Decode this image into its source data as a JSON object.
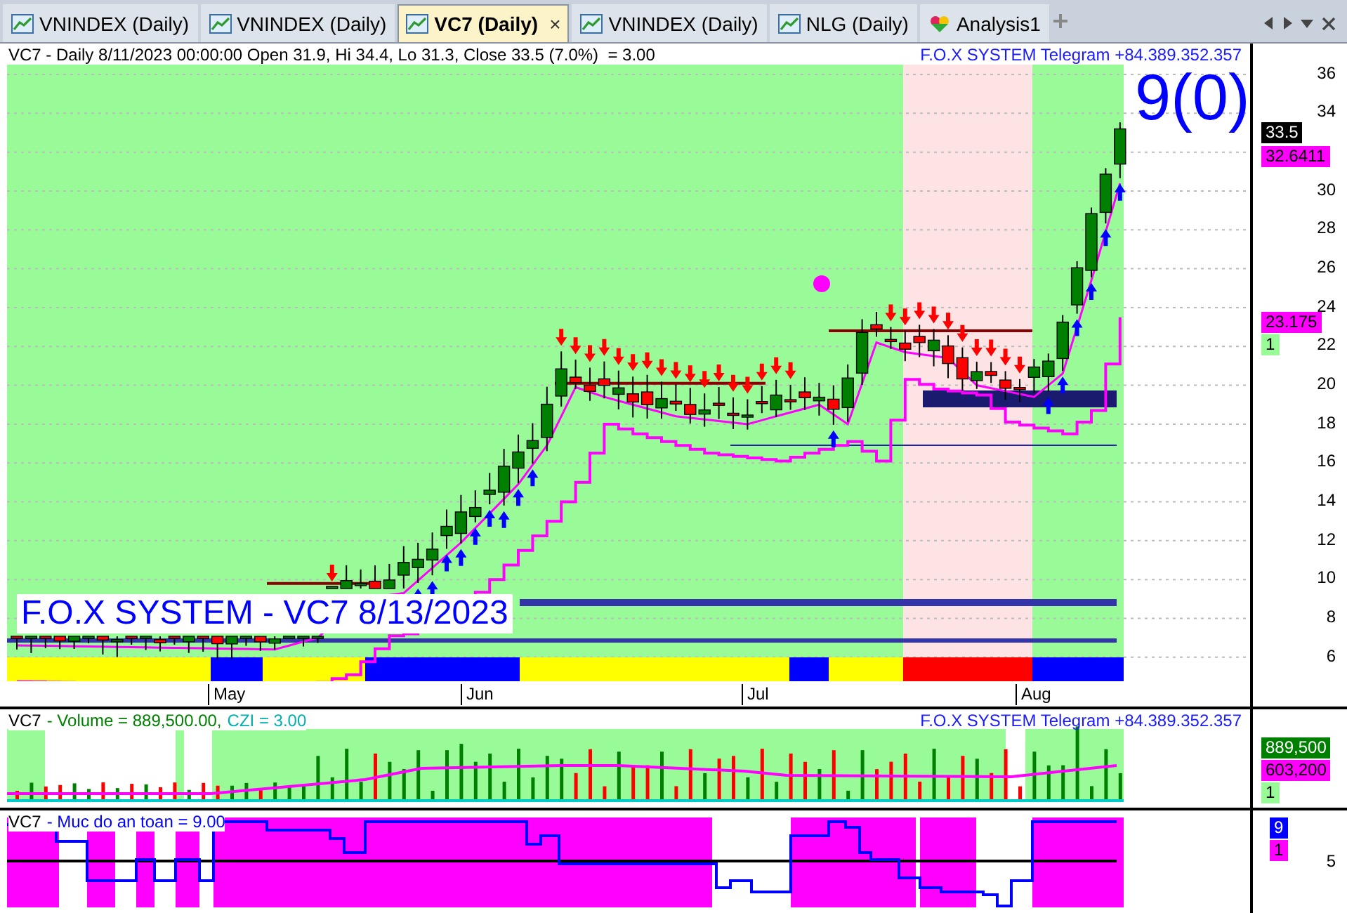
{
  "tabs": [
    {
      "kind": "chart",
      "label": "VNINDEX (Daily)",
      "selected": false
    },
    {
      "kind": "chart",
      "label": "VNINDEX (Daily)",
      "selected": false
    },
    {
      "kind": "chart",
      "label": "VC7 (Daily)",
      "selected": true,
      "close": "×"
    },
    {
      "kind": "chart",
      "label": "VNINDEX (Daily)",
      "selected": false
    },
    {
      "kind": "chart",
      "label": "NLG (Daily)",
      "selected": false
    },
    {
      "kind": "analysis",
      "label": "Analysis1",
      "selected": false
    }
  ],
  "price_pane": {
    "header": "VC7 - Daily 8/11/2023 00:00:00 Open 31.9, Hi 34.4, Lo 31.3, Close 33.5 (7.0%)  = 3.00",
    "signal": "F.O.X SYSTEM Telegram +84.389.352.357",
    "count_label": "9(0)",
    "banner": "F.O.X SYSTEM - VC7 8/13/2023",
    "y_ticks": [
      "36",
      "34",
      "30",
      "28",
      "26",
      "24",
      "22",
      "20",
      "18",
      "16",
      "14",
      "12",
      "10",
      "8",
      "6"
    ],
    "tags": [
      {
        "text": "33.5",
        "color": "#000000"
      },
      {
        "text": "32.6411",
        "color": "#ff00ff"
      },
      {
        "text": "23.175",
        "color": "#ff00ff"
      },
      {
        "text": "1",
        "color": "#98fb98"
      }
    ]
  },
  "x_axis": {
    "months": [
      "May",
      "Jun",
      "Jul",
      "Aug"
    ]
  },
  "volume_pane": {
    "ticker": "VC7",
    "title": "- Volume = 889,500.00,",
    "indicator": "CZI = 3.00",
    "signal": "F.O.X SYSTEM Telegram +84.389.352.357",
    "tags": [
      {
        "text": "889,500",
        "color": "#008000"
      },
      {
        "text": "603,200",
        "color": "#ff00ff"
      },
      {
        "text": "1",
        "color": "#98fb98"
      }
    ]
  },
  "safety_pane": {
    "ticker": "VC7",
    "title": "- Muc do an toan = 9.00",
    "tick": "5",
    "tags": [
      {
        "text": "9",
        "color": "#0000ff"
      },
      {
        "text": "1",
        "color": "#ff00ff"
      }
    ]
  }
}
